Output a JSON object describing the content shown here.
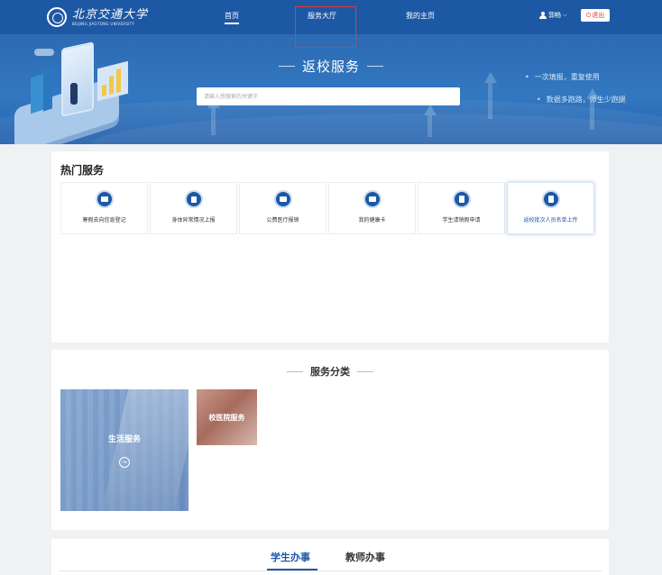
{
  "header": {
    "logo_cn": "北京交通大学",
    "logo_en": "BEIJING JIAOTONG UNIVERSITY",
    "nav": [
      {
        "label": "首页",
        "active": true
      },
      {
        "label": "服务大厅",
        "active": false
      },
      {
        "label": "我的主页",
        "active": false
      }
    ],
    "user_name": "郭畅",
    "logout_label": "退出"
  },
  "banner": {
    "title": "返校服务",
    "search_placeholder": "请输入想搜索的关键字",
    "bullets": [
      "一次填报，重复使用",
      "数据多跑路，师生少跑腿"
    ]
  },
  "hot_services": {
    "title": "热门服务",
    "items": [
      {
        "label": "寒假去向信息登记",
        "icon": "card-icon"
      },
      {
        "label": "身体异常情况上报",
        "icon": "lock-icon"
      },
      {
        "label": "公费医疗报销",
        "icon": "medical-kit-icon"
      },
      {
        "label": "我的健康卡",
        "icon": "card-icon"
      },
      {
        "label": "学生请销假申请",
        "icon": "document-icon"
      },
      {
        "label": "返校批次人员名单上传",
        "icon": "document-icon"
      }
    ]
  },
  "categories": {
    "title": "服务分类",
    "items": [
      {
        "label": "生活服务"
      },
      {
        "label": "校医院服务"
      }
    ]
  },
  "tabs": {
    "items": [
      {
        "label": "学生办事",
        "active": true
      },
      {
        "label": "教师办事",
        "active": false
      }
    ]
  },
  "colors": {
    "primary": "#1d58a5",
    "logout": "#e53935",
    "page_bg": "#f0f1f3"
  }
}
